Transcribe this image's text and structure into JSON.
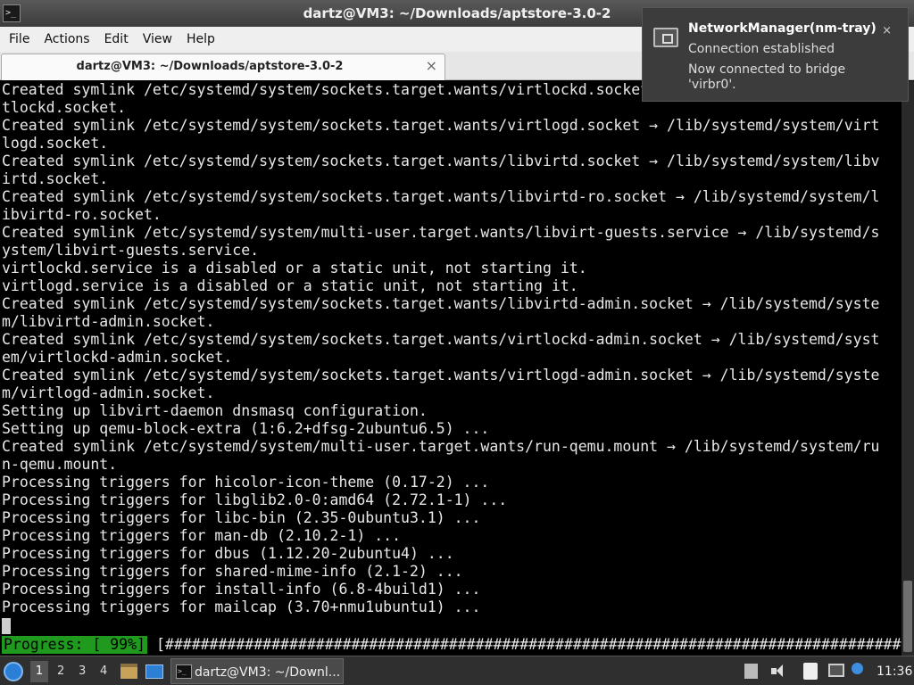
{
  "window": {
    "title": "dartz@VM3: ~/Downloads/aptstore-3.0-2",
    "icon": "terminal-icon"
  },
  "menubar": [
    "File",
    "Actions",
    "Edit",
    "View",
    "Help"
  ],
  "tab": {
    "label": "dartz@VM3: ~/Downloads/aptstore-3.0-2",
    "close": "×"
  },
  "terminal": {
    "lines": [
      "Created symlink /etc/systemd/system/sockets.target.wants/virtlockd.socket → /lib/systemd/system/vir",
      "tlockd.socket.",
      "Created symlink /etc/systemd/system/sockets.target.wants/virtlogd.socket → /lib/systemd/system/virt",
      "logd.socket.",
      "Created symlink /etc/systemd/system/sockets.target.wants/libvirtd.socket → /lib/systemd/system/libv",
      "irtd.socket.",
      "Created symlink /etc/systemd/system/sockets.target.wants/libvirtd-ro.socket → /lib/systemd/system/l",
      "ibvirtd-ro.socket.",
      "Created symlink /etc/systemd/system/multi-user.target.wants/libvirt-guests.service → /lib/systemd/s",
      "ystem/libvirt-guests.service.",
      "virtlockd.service is a disabled or a static unit, not starting it.",
      "virtlogd.service is a disabled or a static unit, not starting it.",
      "Created symlink /etc/systemd/system/sockets.target.wants/libvirtd-admin.socket → /lib/systemd/syste",
      "m/libvirtd-admin.socket.",
      "Created symlink /etc/systemd/system/sockets.target.wants/virtlockd-admin.socket → /lib/systemd/syst",
      "em/virtlockd-admin.socket.",
      "Created symlink /etc/systemd/system/sockets.target.wants/virtlogd-admin.socket → /lib/systemd/syste",
      "m/virtlogd-admin.socket.",
      "Setting up libvirt-daemon dnsmasq configuration.",
      "Setting up qemu-block-extra (1:6.2+dfsg-2ubuntu6.5) ...",
      "Created symlink /etc/systemd/system/multi-user.target.wants/run-qemu.mount → /lib/systemd/system/ru",
      "n-qemu.mount.",
      "Processing triggers for hicolor-icon-theme (0.17-2) ...",
      "Processing triggers for libglib2.0-0:amd64 (2.72.1-1) ...",
      "Processing triggers for libc-bin (2.35-0ubuntu3.1) ...",
      "Processing triggers for man-db (2.10.2-1) ...",
      "Processing triggers for dbus (1.12.20-2ubuntu4) ...",
      "Processing triggers for shared-mime-info (2.1-2) ...",
      "Processing triggers for install-info (6.8-4build1) ...",
      "Processing triggers for mailcap (3.70+nmu1ubuntu1) ..."
    ],
    "progress_label": "Progress: [ 99%]",
    "progress_bar": "[###################################################################################.]",
    "progress_percent": 99
  },
  "notification": {
    "title": "NetworkManager(nm-tray)",
    "line1": "Connection established",
    "line2": "Now connected to bridge 'virbr0'.",
    "close": "×",
    "icon": "network-icon"
  },
  "taskbar": {
    "workspaces": [
      "1",
      "2",
      "3",
      "4"
    ],
    "active_workspace": "1",
    "task_label": "dartz@VM3: ~/Downl...",
    "clock": "11:36"
  },
  "colors": {
    "progress_green": "#1f9a1f",
    "terminal_bg": "#000000",
    "terminal_fg": "#e8e8e8"
  }
}
